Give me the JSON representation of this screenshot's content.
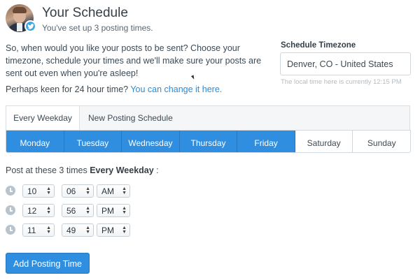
{
  "header": {
    "title": "Your Schedule",
    "subtitle": "You've set up 3 posting times."
  },
  "intro": {
    "text": "So, when would you like your posts to be sent? Choose your timezone, schedule your times and we'll make sure your posts are sent out even when you're asleep!",
    "keen_prefix": "Perhaps keen for 24 hour time? ",
    "keen_link": "You can change it here."
  },
  "timezone": {
    "label": "Schedule Timezone",
    "value": "Denver, CO - United States",
    "note": "The local time here is currently 12:15 PM"
  },
  "tabs": [
    {
      "label": "Every Weekday",
      "active": true
    },
    {
      "label": "New Posting Schedule",
      "active": false
    }
  ],
  "days": [
    {
      "label": "Monday",
      "selected": true
    },
    {
      "label": "Tuesday",
      "selected": true
    },
    {
      "label": "Wednesday",
      "selected": true
    },
    {
      "label": "Thursday",
      "selected": true
    },
    {
      "label": "Friday",
      "selected": true
    },
    {
      "label": "Saturday",
      "selected": false
    },
    {
      "label": "Sunday",
      "selected": false
    }
  ],
  "post_at": {
    "prefix": "Post at these 3 times ",
    "bold": "Every Weekday",
    "suffix": " :"
  },
  "times": [
    {
      "hour": "10",
      "minute": "06",
      "period": "AM"
    },
    {
      "hour": "12",
      "minute": "56",
      "period": "PM"
    },
    {
      "hour": "11",
      "minute": "49",
      "period": "PM"
    }
  ],
  "icons": {
    "clock": "clock-icon",
    "twitter": "twitter-icon",
    "select_arrows": "updown-arrows-icon"
  },
  "colors": {
    "accent": "#2f8ee0",
    "link": "#2c8ad6",
    "twitter": "#3ea9e6"
  },
  "add_button": "Add Posting Time"
}
